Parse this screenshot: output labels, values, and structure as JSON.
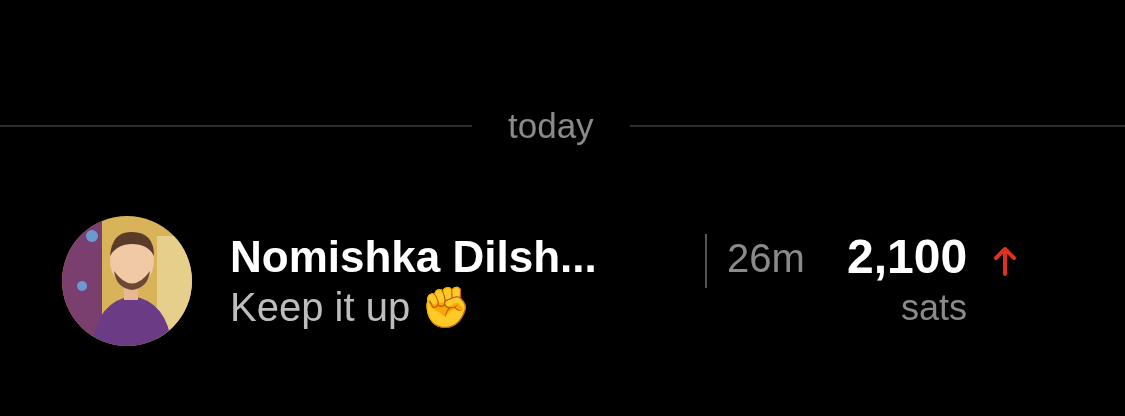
{
  "day_divider": {
    "label": "today"
  },
  "zaps": [
    {
      "name": "Nomishka Dilsh...",
      "time": "26m",
      "message": "Keep it up ✊",
      "amount": "2,100",
      "unit": "sats"
    }
  ]
}
